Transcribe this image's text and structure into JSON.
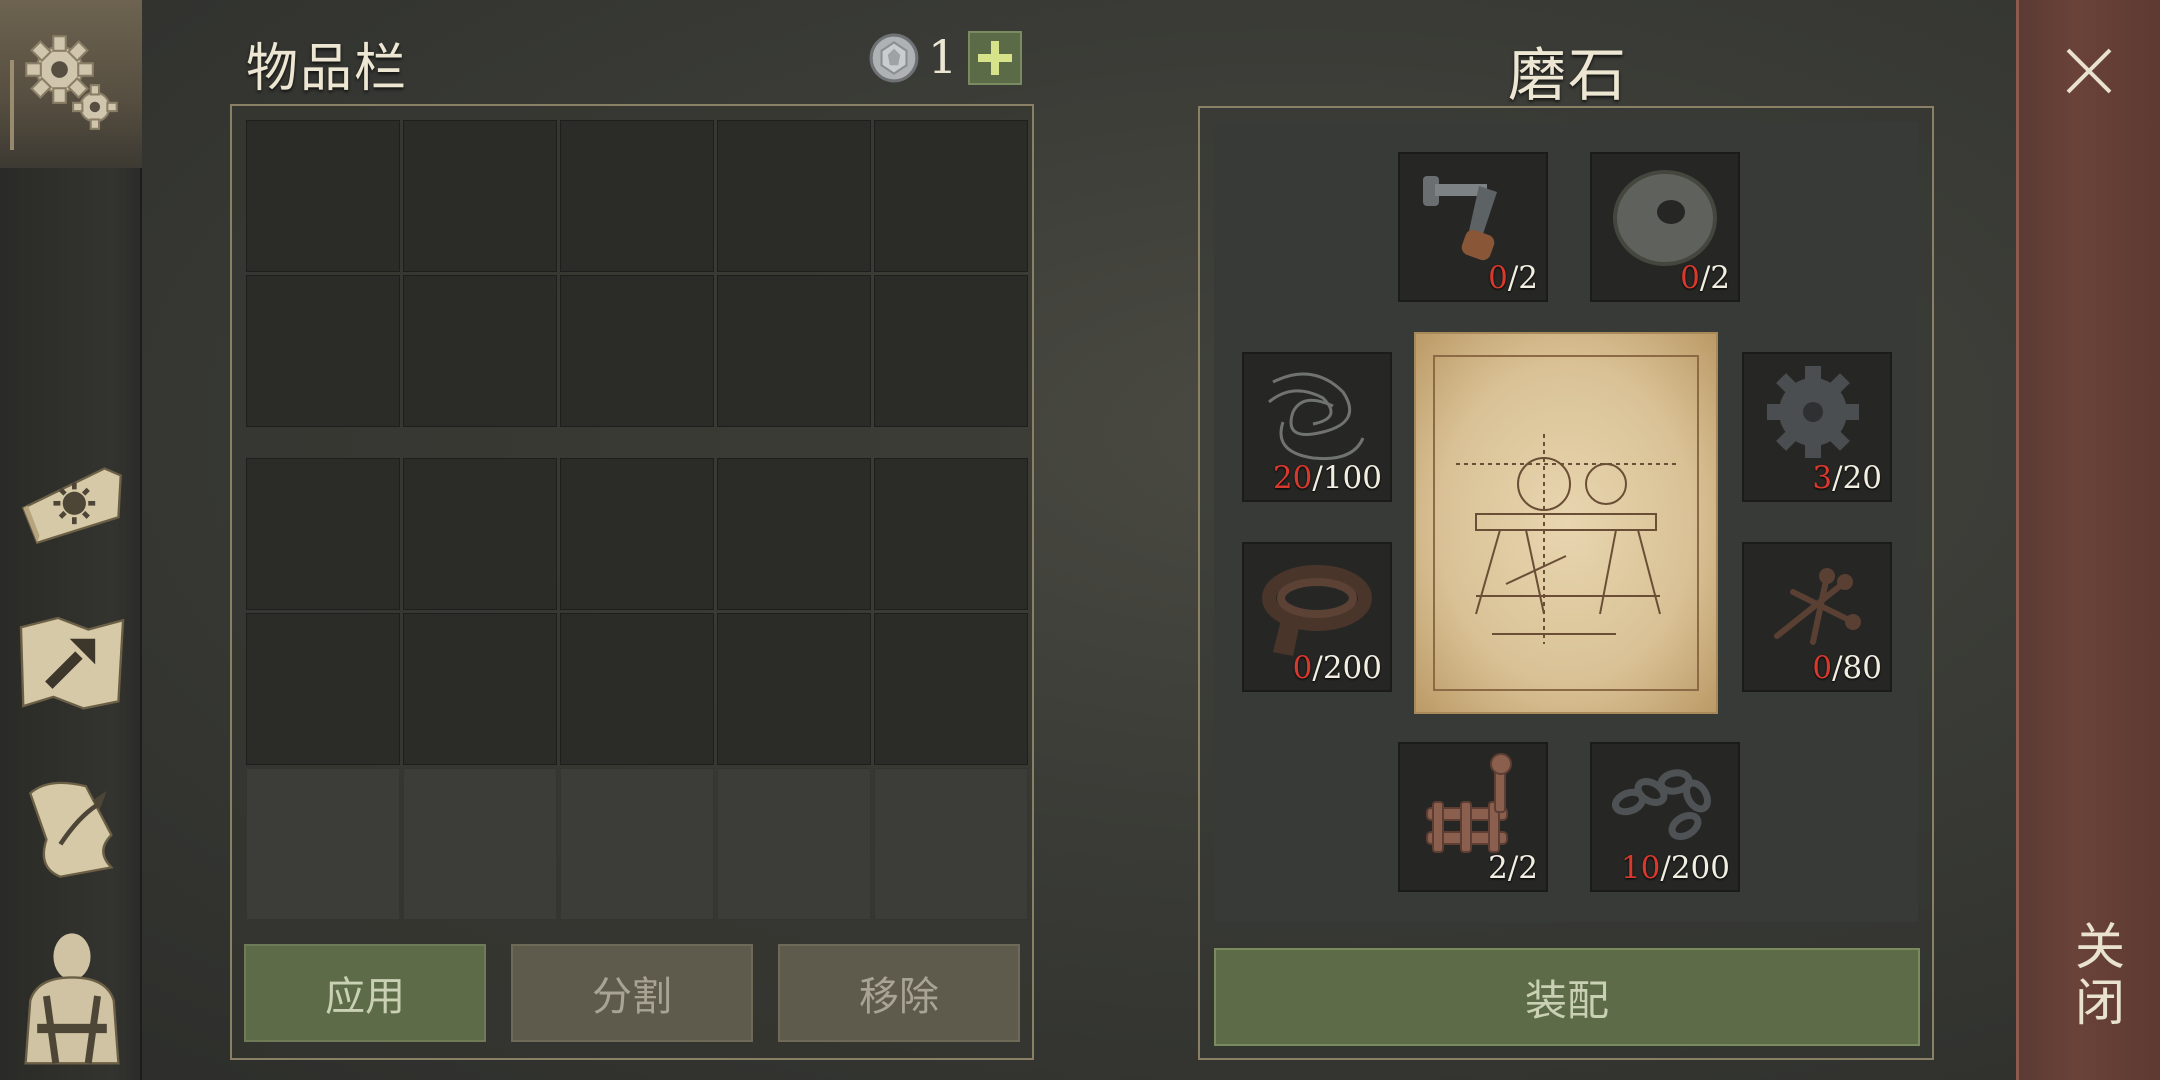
{
  "inventory": {
    "title": "物品栏",
    "coin_icon": "silver-coin-icon",
    "coin_count": "1",
    "rows_open": 4,
    "rows_locked": 1,
    "columns": 5
  },
  "inventory_buttons": {
    "apply": "应用",
    "split": "分割",
    "remove": "移除"
  },
  "crafting": {
    "title": "磨石",
    "blueprint_icon": "grindstone-blueprint",
    "assemble_label": "装配",
    "ingredients": [
      {
        "icon": "crank-handle-icon",
        "have": "0",
        "need": "/2"
      },
      {
        "icon": "stone-wheel-icon",
        "have": "0",
        "need": "/2"
      },
      {
        "icon": "wire-coil-icon",
        "have": "20",
        "need": "/100"
      },
      {
        "icon": "gear-icon",
        "have": "3",
        "need": "/20"
      },
      {
        "icon": "leather-strap-icon",
        "have": "0",
        "need": "/200"
      },
      {
        "icon": "nails-icon",
        "have": "0",
        "need": "/80"
      },
      {
        "icon": "clamp-icon",
        "have": "2",
        "need": "/2"
      },
      {
        "icon": "chain-icon",
        "have": "10",
        "need": "/200"
      }
    ]
  },
  "sidebar": {
    "items": [
      "settings-gear-icon",
      "journal-book-icon",
      "crafting-map-icon",
      "quest-scroll-icon",
      "character-backpack-icon"
    ]
  },
  "close": {
    "label": "关闭"
  },
  "colors": {
    "accent_green": "#5d6b48",
    "count_red": "#d9382d",
    "close_bar": "#6a4238"
  }
}
